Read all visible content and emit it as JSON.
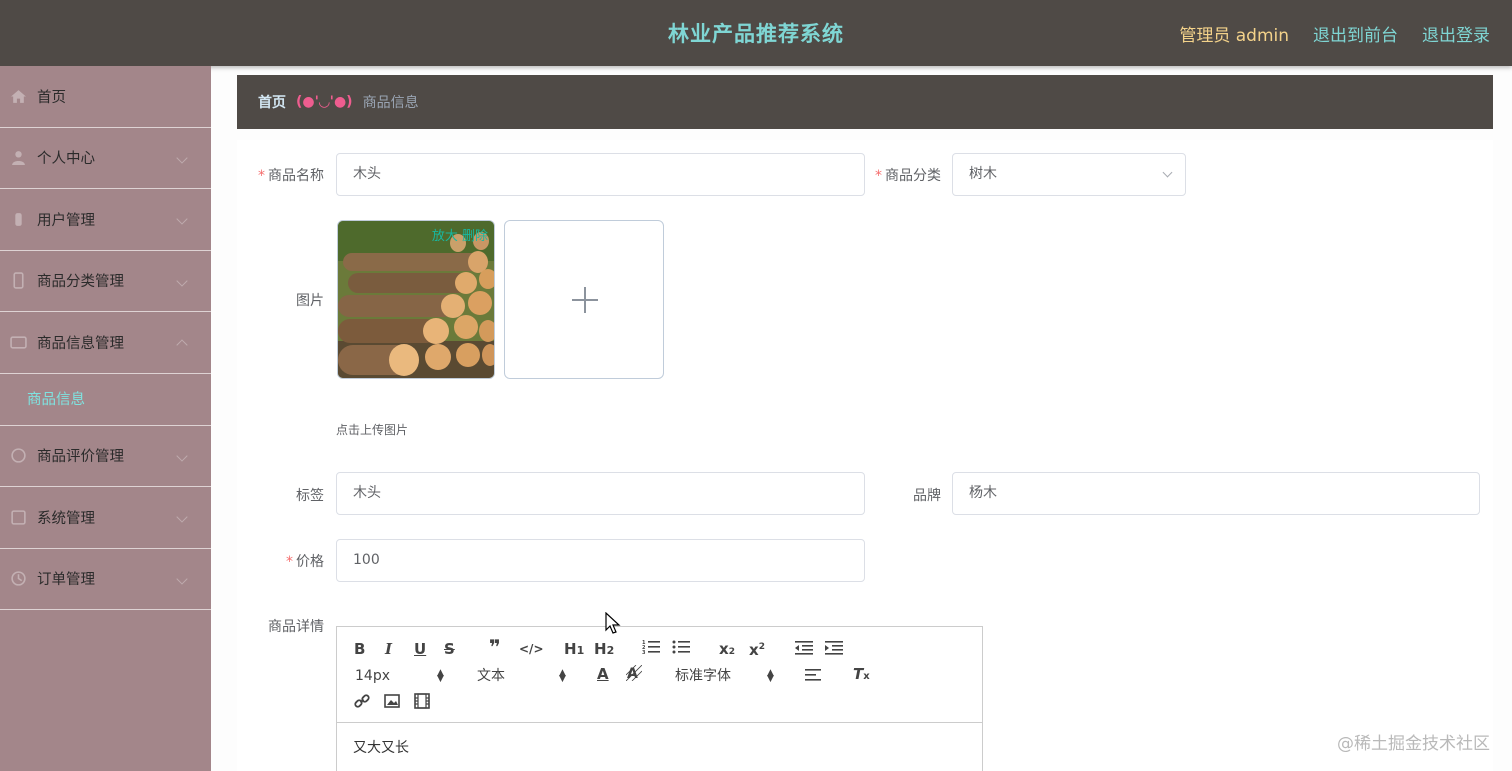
{
  "header": {
    "title": "林业产品推荐系统",
    "admin_text": "管理员 admin",
    "front_link": "退出到前台",
    "logout_link": "退出登录"
  },
  "sidebar": {
    "items": [
      {
        "label": "首页",
        "icon": "home-icon"
      },
      {
        "label": "个人中心",
        "icon": "user-icon"
      },
      {
        "label": "用户管理",
        "icon": "users-icon"
      },
      {
        "label": "商品分类管理",
        "icon": "category-icon"
      },
      {
        "label": "商品信息管理",
        "icon": "goods-icon"
      },
      {
        "label": "商品评价管理",
        "icon": "comment-icon"
      },
      {
        "label": "系统管理",
        "icon": "system-icon"
      },
      {
        "label": "订单管理",
        "icon": "order-icon"
      }
    ],
    "active_submenu": "商品信息"
  },
  "breadcrumb": {
    "home": "首页",
    "separator": "(●'◡'●)",
    "current": "商品信息"
  },
  "form": {
    "name_label": "商品名称",
    "name_value": "木头",
    "category_label": "商品分类",
    "category_value": "树木",
    "image_label": "图片",
    "image_actions": "放大 删除",
    "upload_tip": "点击上传图片",
    "tag_label": "标签",
    "tag_value": "木头",
    "brand_label": "品牌",
    "brand_value": "杨木",
    "price_label": "价格",
    "price_value": "100",
    "detail_label": "商品详情"
  },
  "editor": {
    "font_size": "14px",
    "header_select": "文本",
    "font_family": "标准字体",
    "content": "又大又长"
  },
  "watermark": "@稀土掘金技术社区",
  "colors": {
    "header_bg": "#4f4a46",
    "sidebar_bg": "#a3868a",
    "accent": "#7fd6d4",
    "admin": "#f3d28a",
    "required": "#f56c6c"
  }
}
